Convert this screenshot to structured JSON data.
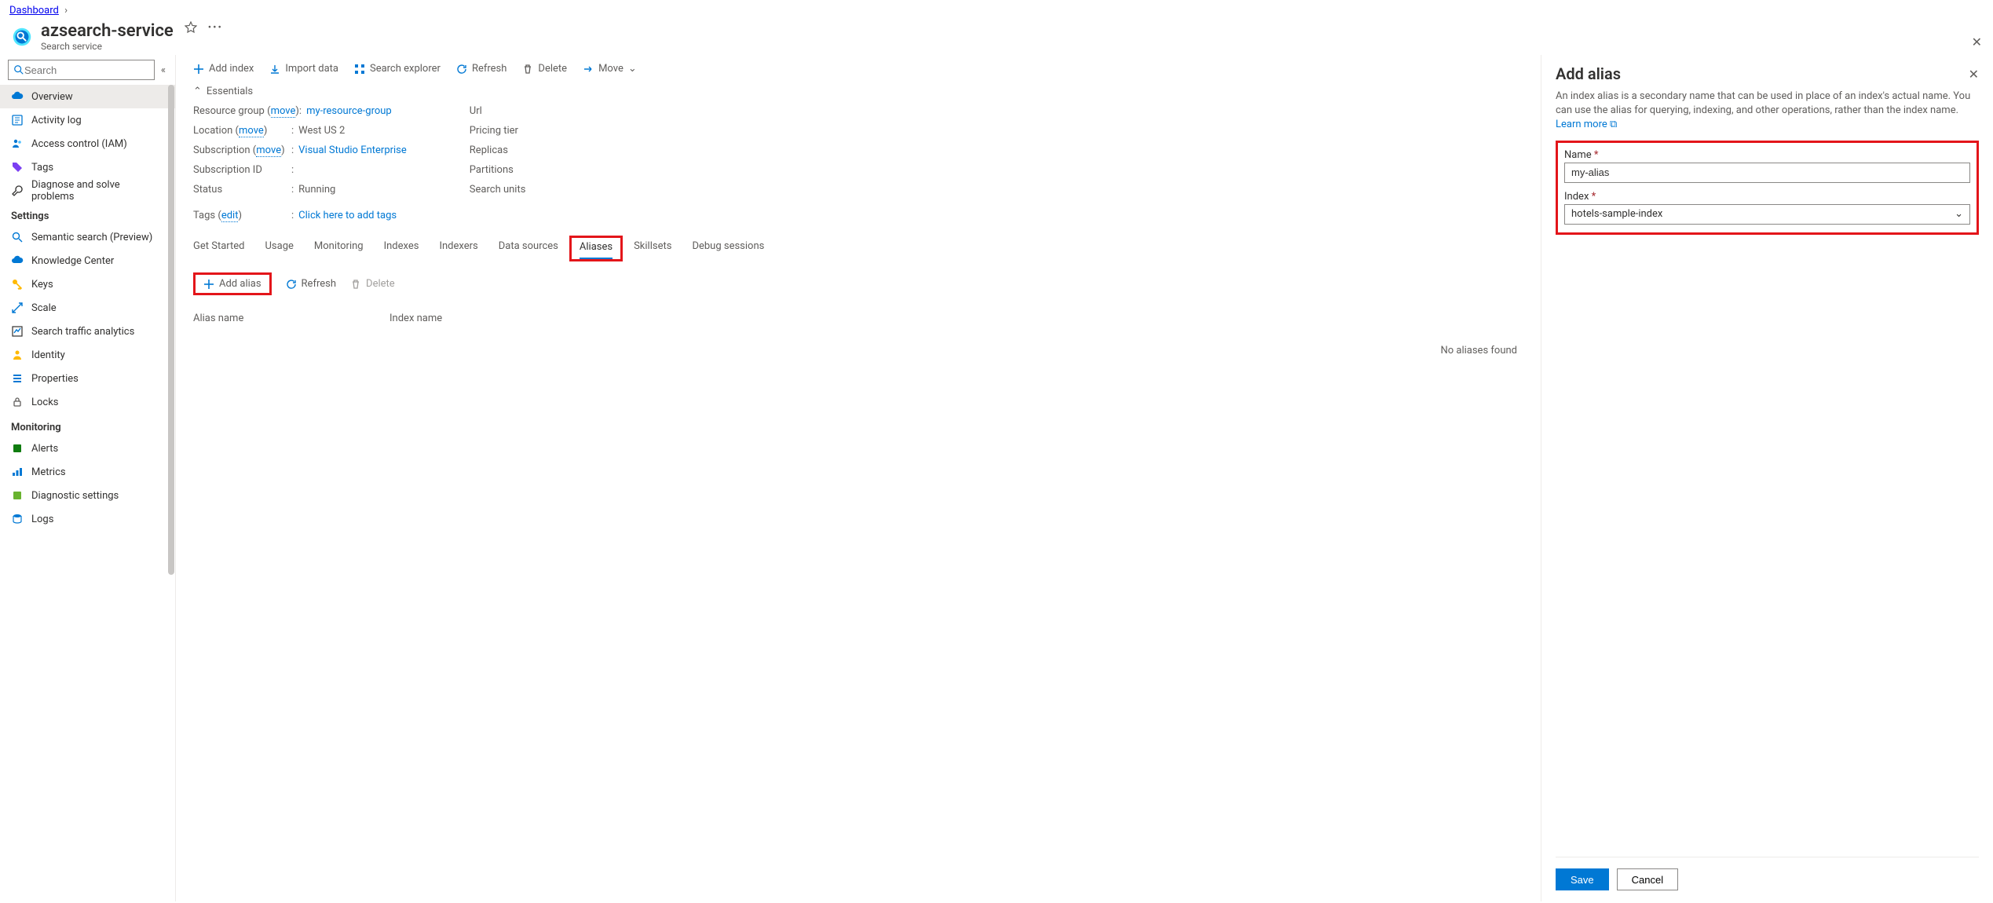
{
  "breadcrumb": {
    "root": "Dashboard"
  },
  "resource": {
    "title": "azsearch-service",
    "subtitle": "Search service"
  },
  "search": {
    "placeholder": "Search"
  },
  "nav": {
    "overview": "Overview",
    "activity": "Activity log",
    "iam": "Access control (IAM)",
    "tags": "Tags",
    "diag": "Diagnose and solve problems",
    "group_settings": "Settings",
    "semantic": "Semantic search (Preview)",
    "knowledge": "Knowledge Center",
    "keys": "Keys",
    "scale": "Scale",
    "traffic": "Search traffic analytics",
    "identity": "Identity",
    "properties": "Properties",
    "locks": "Locks",
    "group_monitoring": "Monitoring",
    "alerts": "Alerts",
    "metrics": "Metrics",
    "diagsettings": "Diagnostic settings",
    "logs": "Logs"
  },
  "toolbar": {
    "add_index": "Add index",
    "import_data": "Import data",
    "search_exp": "Search explorer",
    "refresh": "Refresh",
    "delete": "Delete",
    "move": "Move"
  },
  "essentials": {
    "toggle": "Essentials",
    "rg_label": "Resource group",
    "move_label": "move",
    "rg_value": "my-resource-group",
    "loc_label": "Location",
    "loc_value": "West US 2",
    "sub_label": "Subscription",
    "sub_value": "Visual Studio Enterprise",
    "subid_label": "Subscription ID",
    "subid_value": "",
    "status_label": "Status",
    "status_value": "Running",
    "url_label": "Url",
    "tier_label": "Pricing tier",
    "repl_label": "Replicas",
    "part_label": "Partitions",
    "units_label": "Search units",
    "tags_label": "Tags",
    "edit_label": "edit",
    "tags_value": "Click here to add tags"
  },
  "tabs": {
    "get_started": "Get Started",
    "usage": "Usage",
    "monitoring": "Monitoring",
    "indexes": "Indexes",
    "indexers": "Indexers",
    "data_sources": "Data sources",
    "aliases": "Aliases",
    "skillsets": "Skillsets",
    "debug": "Debug sessions"
  },
  "sub_toolbar": {
    "add_alias": "Add alias",
    "refresh": "Refresh",
    "delete": "Delete"
  },
  "table": {
    "alias_name": "Alias name",
    "index_name": "Index name",
    "empty": "No aliases found"
  },
  "panel": {
    "title": "Add alias",
    "desc": "An index alias is a secondary name that can be used in place of an index's actual name. You can use the alias for querying, indexing, and other operations, rather than the index name.",
    "learn_more": "Learn more",
    "name_label": "Name",
    "name_value": "my-alias",
    "index_label": "Index",
    "index_value": "hotels-sample-index",
    "save": "Save",
    "cancel": "Cancel"
  }
}
